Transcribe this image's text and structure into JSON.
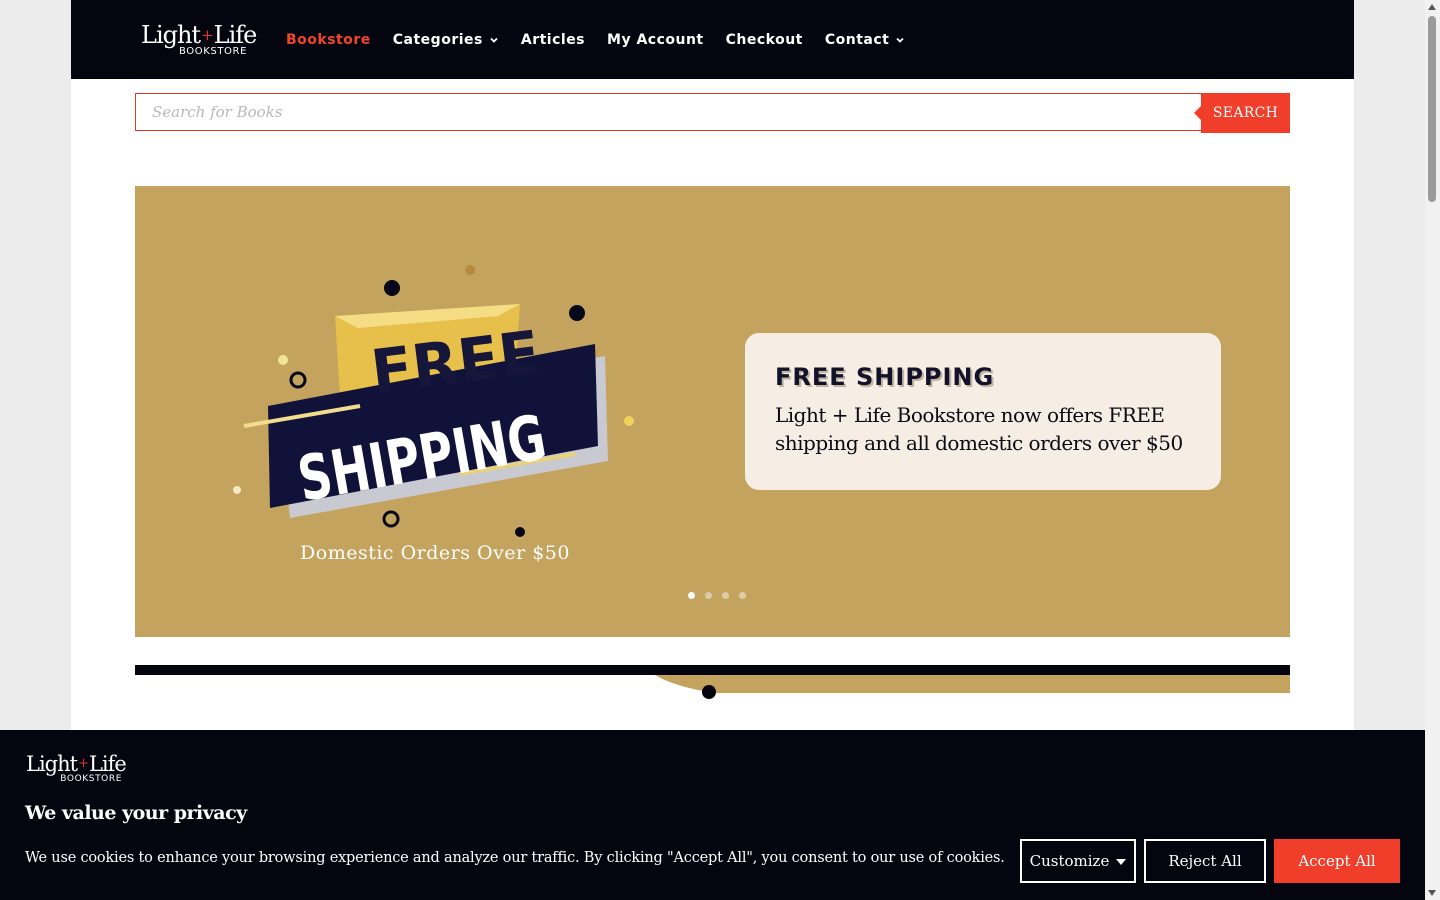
{
  "brand": {
    "logo_main_left": "Light",
    "logo_plus": "+",
    "logo_main_right": "Life",
    "logo_sub": "BOOKSTORE",
    "accent_color": "#f03e2a",
    "dark_color": "#05050f",
    "gold_color": "#c4a35f"
  },
  "nav": {
    "items": [
      {
        "label": "Bookstore",
        "active": true,
        "has_dropdown": false
      },
      {
        "label": "Categories",
        "active": false,
        "has_dropdown": true
      },
      {
        "label": "Articles",
        "active": false,
        "has_dropdown": false
      },
      {
        "label": "My Account",
        "active": false,
        "has_dropdown": false
      },
      {
        "label": "Checkout",
        "active": false,
        "has_dropdown": false
      },
      {
        "label": "Contact",
        "active": false,
        "has_dropdown": true
      }
    ]
  },
  "search": {
    "placeholder": "Search for Books",
    "value": "",
    "button_label": "SEARCH"
  },
  "hero": {
    "art_free": "FREE",
    "art_shipping": "SHIPPING",
    "art_caption": "Domestic Orders Over $50",
    "card_title": "FREE SHIPPING",
    "card_text": "Light + Life Bookstore now offers FREE shipping and all domestic orders over $50",
    "slide_count": 4,
    "active_slide": 1
  },
  "cookie": {
    "title": "We value your privacy",
    "text": "We use cookies to enhance your browsing experience and analyze our traffic. By clicking \"Accept All\", you consent to our use of cookies.",
    "customize_label": "Customize",
    "reject_label": "Reject All",
    "accept_label": "Accept All"
  }
}
